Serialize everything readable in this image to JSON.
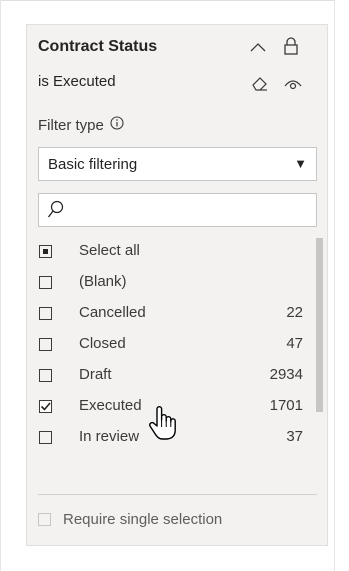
{
  "slicer": {
    "title": "Contract Status",
    "subtitle": "is Executed",
    "filter_type_label": "Filter type",
    "filter_type_value": "Basic filtering",
    "search_placeholder": "",
    "items": [
      {
        "label": "Select all",
        "count": "",
        "state": "partial"
      },
      {
        "label": "(Blank)",
        "count": "",
        "state": "unchecked"
      },
      {
        "label": "Cancelled",
        "count": "22",
        "state": "unchecked"
      },
      {
        "label": "Closed",
        "count": "47",
        "state": "unchecked"
      },
      {
        "label": "Draft",
        "count": "2934",
        "state": "unchecked"
      },
      {
        "label": "Executed",
        "count": "1701",
        "state": "checked"
      },
      {
        "label": "In review",
        "count": "37",
        "state": "unchecked"
      }
    ],
    "require_single_selection_label": "Require single selection"
  },
  "icons": {
    "collapse": "chevron-up-icon",
    "lock": "lock-icon",
    "eraser": "eraser-icon",
    "visibility": "eye-icon",
    "info": "info-icon",
    "search": "search-icon",
    "dropdown": "caret-down-icon",
    "cursor": "hand-pointer-icon"
  },
  "colors": {
    "card_bg": "#f3f2f1",
    "text": "#252423",
    "scrollbar": "#c8c6c4"
  }
}
